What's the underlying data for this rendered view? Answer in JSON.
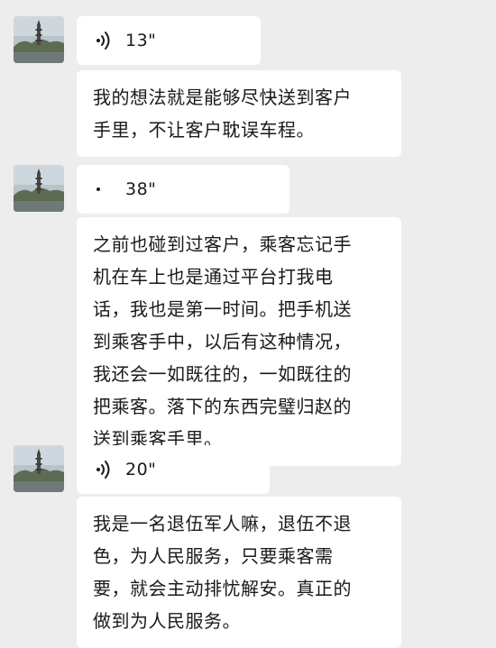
{
  "messages": [
    {
      "voice_duration": "13\"",
      "text": "我的想法就是能够尽快送到客户\n手里，不让客户耽误车程。"
    },
    {
      "voice_duration": "38\"",
      "text": "之前也碰到过客户，乘客忘记手\n机在车上也是通过平台打我电\n话，我也是第一时间。把手机送\n到乘客手中，以后有这种情况，\n我还会一如既往的，一如既往的\n把乘客。落下的东西完璧归赵的\n送到乘客手里。"
    },
    {
      "voice_duration": "20\"",
      "text": "我是一名退伍军人嘛，退伍不退\n色，为人民服务，只要乘客需\n要，就会主动排忧解安。真正的\n做到为人民服务。"
    }
  ],
  "colors": {
    "background": "#ededed",
    "bubble": "#ffffff",
    "text": "#1a1a1a"
  },
  "icons": {
    "voice": "voice-wave-icon",
    "avatar": "pagoda-landscape-avatar"
  }
}
